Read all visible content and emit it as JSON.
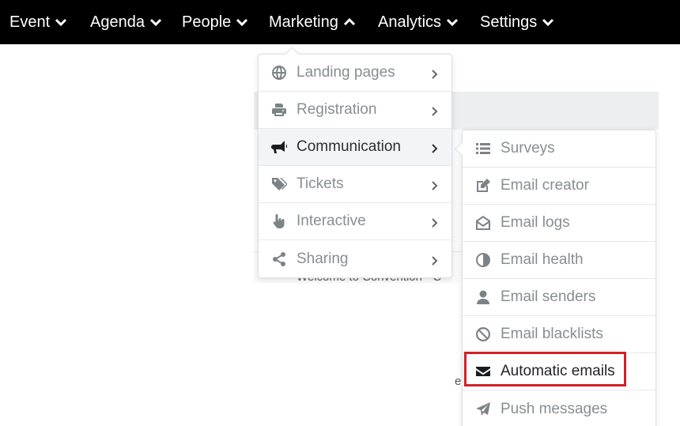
{
  "nav": {
    "items": [
      {
        "label": "Event",
        "open": false
      },
      {
        "label": "Agenda",
        "open": false
      },
      {
        "label": "People",
        "open": false
      },
      {
        "label": "Marketing",
        "open": true
      },
      {
        "label": "Analytics",
        "open": false
      },
      {
        "label": "Settings",
        "open": false
      }
    ]
  },
  "background": {
    "text": "Welcome to Convention - C",
    "fragment": "e"
  },
  "marketing_menu": {
    "items": [
      {
        "label": "Landing pages",
        "icon": "globe-icon"
      },
      {
        "label": "Registration",
        "icon": "printer-icon"
      },
      {
        "label": "Communication",
        "icon": "megaphone-icon",
        "active": true
      },
      {
        "label": "Tickets",
        "icon": "tags-icon"
      },
      {
        "label": "Interactive",
        "icon": "hand-pointer-icon"
      },
      {
        "label": "Sharing",
        "icon": "share-icon"
      }
    ]
  },
  "communication_menu": {
    "items": [
      {
        "label": "Surveys",
        "icon": "list-icon"
      },
      {
        "label": "Email creator",
        "icon": "edit-icon"
      },
      {
        "label": "Email logs",
        "icon": "envelope-open-icon"
      },
      {
        "label": "Email health",
        "icon": "half-circle-icon"
      },
      {
        "label": "Email senders",
        "icon": "user-icon"
      },
      {
        "label": "Email blacklists",
        "icon": "ban-icon"
      },
      {
        "label": "Automatic emails",
        "icon": "envelope-icon",
        "highlighted": true
      },
      {
        "label": "Push messages",
        "icon": "paper-plane-icon"
      }
    ]
  },
  "colors": {
    "nav_bg": "#000000",
    "highlight_border": "#d42027",
    "muted_text": "#888e92"
  }
}
